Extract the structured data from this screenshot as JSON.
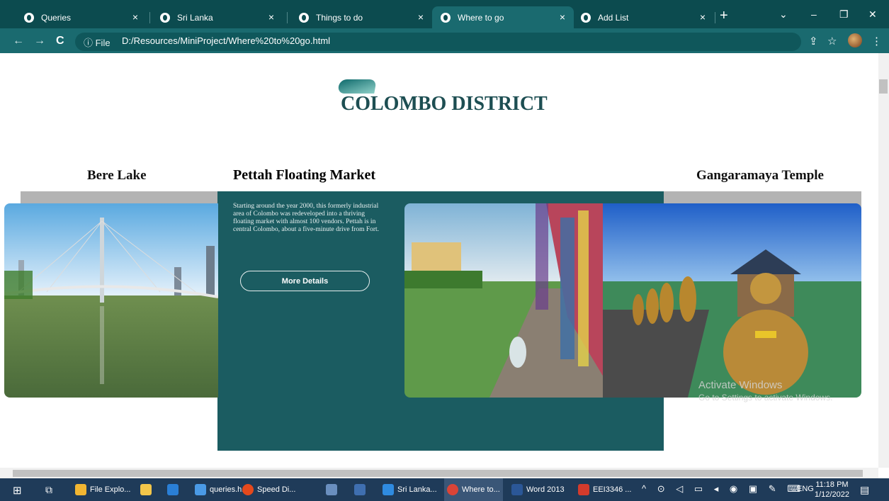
{
  "browser": {
    "tabs": [
      {
        "label": "Queries",
        "active": false
      },
      {
        "label": "Sri Lanka",
        "active": false
      },
      {
        "label": "Things to do",
        "active": false
      },
      {
        "label": "Where to go",
        "active": true
      },
      {
        "label": "Add List",
        "active": false
      }
    ],
    "address_prefix": "ⓘ File",
    "url": "D:/Resources/MiniProject/Where%20to%20go.html"
  },
  "page": {
    "brand": "COLOMBO DISTRICT",
    "cards": {
      "left_title": "Bere Lake",
      "mid_title": "Pettah Floating Market",
      "mid_description": "Starting around the year 2000, this formerly industrial area of Colombo was redeveloped into a thriving floating market with almost 100 vendors. Pettah is in central Colombo, about a five-minute drive from Fort.",
      "mid_button": "More Details",
      "right_title": "Gangaramaya Temple"
    },
    "watermark": "Activate Windows",
    "watermark_sub": "Go to Settings to activate Windows."
  },
  "taskbar": {
    "items": [
      {
        "label": "File Explo...",
        "color": "#f2b632"
      },
      {
        "label": "queries.h...",
        "color": "#4a9ae6"
      },
      {
        "label": "Speed Di...",
        "color": "#e5491c"
      },
      {
        "label": "Sri Lanka...",
        "color": "#2f8be0"
      },
      {
        "label": "Where to...",
        "color": "#db4437"
      },
      {
        "label": "Word 2013",
        "color": "#2b5797"
      },
      {
        "label": "EEI3346 ...",
        "color": "#d33b2c"
      }
    ],
    "lang": "ENG",
    "time": "11:18 PM",
    "date": "1/12/2022"
  },
  "colors": {
    "tabbar": "#0c4b4f",
    "toolbar": "#1a6a6f",
    "card_mid": "#1b5c61",
    "card_side": "#b3b3b3",
    "brand_text": "#1d4e52"
  }
}
